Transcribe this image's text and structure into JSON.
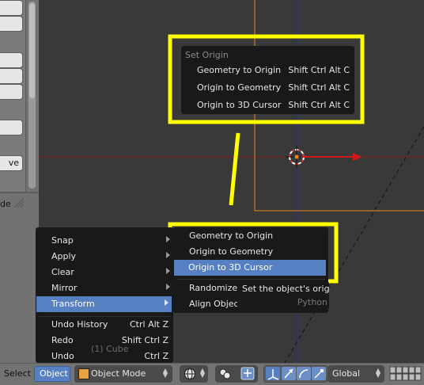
{
  "set_origin_menu": {
    "title": "Set Origin",
    "items": [
      {
        "label": "Geometry to Origin",
        "shortcut": "Shift Ctrl Alt C"
      },
      {
        "label": "Origin to Geometry",
        "shortcut": "Shift Ctrl Alt C"
      },
      {
        "label": "Origin to 3D Cursor",
        "shortcut": "Shift Ctrl Alt C"
      }
    ]
  },
  "object_menu": {
    "items": [
      {
        "label": "Snap"
      },
      {
        "label": "Apply"
      },
      {
        "label": "Clear"
      },
      {
        "label": "Mirror"
      },
      {
        "label": "Transform"
      },
      {
        "label": "Undo History",
        "shortcut": "Ctrl Alt Z"
      },
      {
        "label": "Redo",
        "shortcut": "Shift Ctrl Z"
      },
      {
        "label": "Undo",
        "shortcut": "Ctrl Z"
      }
    ]
  },
  "transform_submenu": {
    "items": [
      {
        "label": "Geometry to Origin"
      },
      {
        "label": "Origin to Geometry"
      },
      {
        "label": "Origin to 3D Cursor"
      },
      {
        "label": "Randomize T"
      },
      {
        "label": "Align Object"
      }
    ]
  },
  "tooltip": {
    "text": "Set the object's origin,",
    "python": "Python"
  },
  "viewport": {
    "object_label": "(1) Cube"
  },
  "left_panel": {
    "ve_label": "ve",
    "de_label": "de"
  },
  "header": {
    "select_label": "Select",
    "object_label": "Object",
    "mode_label": "Object Mode",
    "orientation_label": "Global"
  },
  "colors": {
    "highlight": "#5680c2",
    "annotation": "#ffff00",
    "axis_x": "#8b1d1d",
    "axis_z": "#2c2c9b",
    "selected_outline": "#e8891e"
  }
}
